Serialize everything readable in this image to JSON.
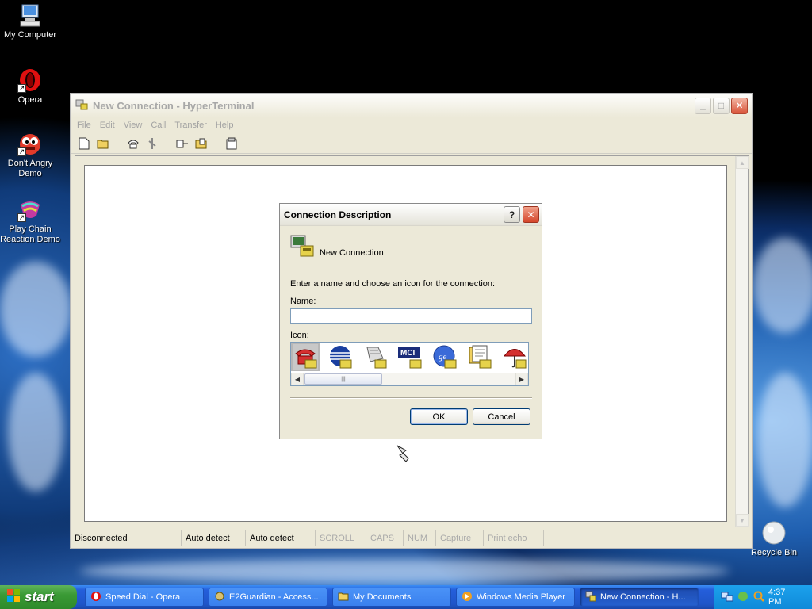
{
  "desktop": {
    "icons": [
      {
        "label": "My Computer"
      },
      {
        "label": "Opera"
      },
      {
        "label": "Don't Angry Demo"
      },
      {
        "label": "Play Chain Reaction Demo"
      }
    ],
    "recycle_bin": "Recycle Bin"
  },
  "hyperterminal": {
    "title": "New Connection - HyperTerminal",
    "menu": [
      "File",
      "Edit",
      "View",
      "Call",
      "Transfer",
      "Help"
    ],
    "toolbar": [
      "new-icon",
      "open-icon",
      "call-icon",
      "disconnect-icon",
      "send-icon",
      "receive-icon",
      "properties-icon"
    ],
    "status": {
      "connection": "Disconnected",
      "detect1": "Auto detect",
      "detect2": "Auto detect",
      "scroll": "SCROLL",
      "caps": "CAPS",
      "num": "NUM",
      "capture": "Capture",
      "print_echo": "Print echo"
    }
  },
  "dialog": {
    "title": "Connection Description",
    "help_glyph": "?",
    "header_label": "New Connection",
    "instruction": "Enter a name and choose an icon for the connection:",
    "name_label": "Name:",
    "name_value": "",
    "icon_label": "Icon:",
    "icons": [
      "telephone-icon",
      "globe-icon",
      "fax-icon",
      "mci-icon",
      "ge-icon",
      "documents-icon",
      "umbrella-icon"
    ],
    "mci_text": "MCI",
    "ge_text": "ge",
    "ok_label": "OK",
    "cancel_label": "Cancel"
  },
  "taskbar": {
    "start_label": "start",
    "tasks": [
      {
        "label": "Speed Dial - Opera"
      },
      {
        "label": "E2Guardian - Access..."
      },
      {
        "label": "My Documents"
      },
      {
        "label": "Windows Media Player"
      },
      {
        "label": "New Connection - H..."
      }
    ],
    "clock": "4:37 PM"
  },
  "colors": {
    "taskbar_blue": "#245edb",
    "start_green": "#3a9a35",
    "xp_beige": "#ece9d8"
  }
}
